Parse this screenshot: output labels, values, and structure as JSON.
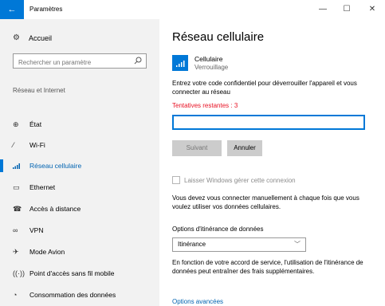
{
  "window": {
    "title": "Paramètres",
    "back_icon": "back-arrow-icon",
    "controls": [
      "minimize-icon",
      "maximize-icon",
      "close-icon"
    ]
  },
  "sidebar": {
    "home": {
      "label": "Accueil",
      "icon": "gear-icon"
    },
    "search": {
      "placeholder": "Rechercher un paramètre",
      "icon": "search-icon"
    },
    "section_title": "Réseau et Internet",
    "items": [
      {
        "label": "État",
        "icon": "globe-icon"
      },
      {
        "label": "Wi-Fi",
        "icon": "wifi-icon"
      },
      {
        "label": "Réseau cellulaire",
        "icon": "cellular-signal-icon",
        "active": true
      },
      {
        "label": "Ethernet",
        "icon": "ethernet-icon"
      },
      {
        "label": "Accès à distance",
        "icon": "dialup-icon"
      },
      {
        "label": "VPN",
        "icon": "vpn-icon"
      },
      {
        "label": "Mode Avion",
        "icon": "airplane-icon"
      },
      {
        "label": "Point d'accès sans fil mobile",
        "icon": "hotspot-icon"
      },
      {
        "label": "Consommation des données",
        "icon": "data-usage-icon"
      }
    ]
  },
  "main": {
    "title": "Réseau cellulaire",
    "cellular": {
      "name": "Cellulaire",
      "status": "Verrouillage"
    },
    "prompt": "Entrez votre code confidentiel pour déverrouiller l'appareil et vous connecter au réseau",
    "attempts": "Tentatives restantes : 3",
    "pin_value": "",
    "buttons": {
      "next": "Suivant",
      "cancel": "Annuler"
    },
    "checkbox_label": "Laisser Windows gérer cette connexion",
    "manual_text": "Vous devez vous connecter manuellement à chaque fois que vous voulez utiliser vos données cellulaires.",
    "roaming_label": "Options d'itinérance de données",
    "roaming_value": "Itinérance",
    "roaming_desc": "En fonction de votre accord de service, l'utilisation de l'itinérance de données peut entraîner des frais supplémentaires.",
    "advanced_link": "Options avancées"
  },
  "colors": {
    "accent": "#0078d7",
    "warning": "#e81123",
    "link": "#0063b1",
    "sidebar_bg": "#f2f2f2"
  }
}
